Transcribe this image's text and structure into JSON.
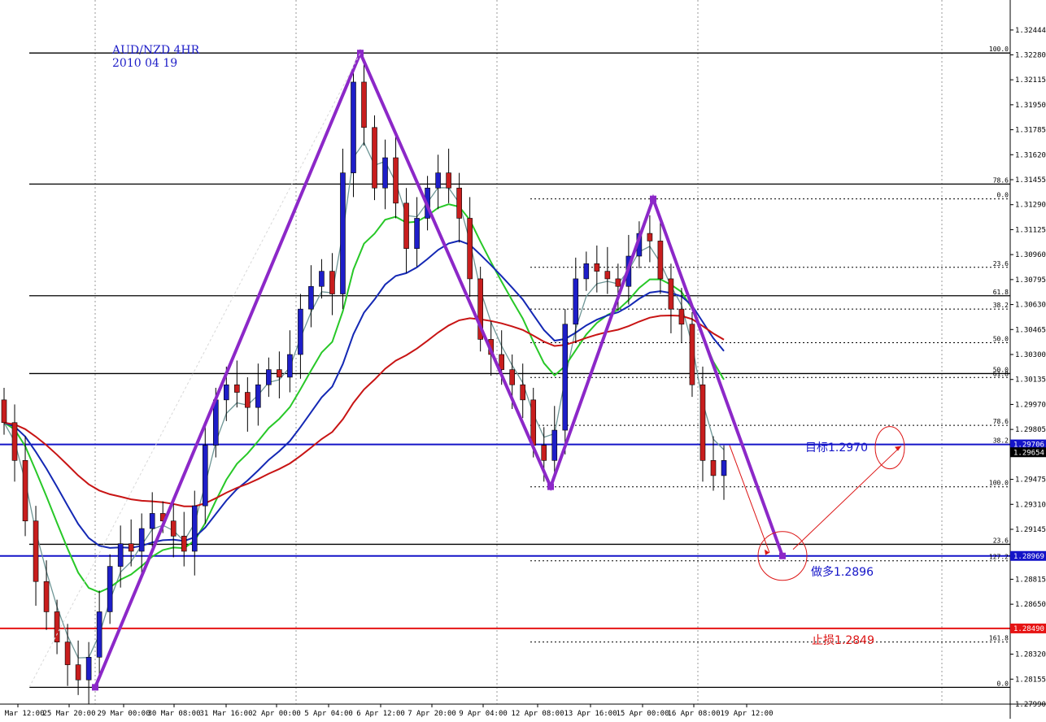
{
  "colors": {
    "background": "#ffffff",
    "bull_candle": "#1e1ec8",
    "bear_candle": "#c81e1e",
    "pattern": "#8c28c8",
    "support_line": "#1414c8",
    "stop_line": "#e61414",
    "ma_fast": "#6e9696",
    "ma_green": "#28c828",
    "ma_blue": "#1428b4",
    "ma_red": "#c81414",
    "arrow": "#dc1414"
  },
  "header": {
    "symbol": "AUD/NZD 4HR",
    "date": "2010 04 19"
  },
  "annotations": {
    "target": "目标1.2970",
    "buy": "做多1.2896",
    "stop": "止损1.2849"
  },
  "chart_data": {
    "type": "candlestick",
    "title": "AUD/NZD 4HR",
    "subtitle": "2010 04 19",
    "ylim": [
      1.2799,
      1.3261
    ],
    "y_ticks": [
      1.3228,
      1.3195,
      1.3162,
      1.3129,
      1.3096,
      1.3063,
      1.303,
      1.2997,
      1.2964,
      1.2931,
      1.2898,
      1.2865,
      1.2832,
      1.2799,
      1.32444,
      1.3228,
      1.32115,
      1.3195,
      1.31785,
      1.3162,
      1.31455,
      1.3129,
      1.31125,
      1.3096,
      1.30795,
      1.3063,
      1.30465,
      1.303,
      1.30135,
      1.2997,
      1.29805,
      1.2964,
      1.29475,
      1.2931,
      1.29145,
      1.2898,
      1.28815,
      1.2865,
      1.28485,
      1.2832,
      1.28155,
      1.2799
    ],
    "y_tick_labels": [
      "1.32444",
      "1.32280",
      "1.32115",
      "1.31950",
      "1.31785",
      "1.31620",
      "1.31455",
      "1.31290",
      "1.31125",
      "1.30960",
      "1.30795",
      "1.30630",
      "1.30465",
      "1.30300",
      "1.30135",
      "1.29970",
      "1.29805",
      "1.29640",
      "1.29475",
      "1.29310",
      "1.29145",
      "1.28980",
      "1.28815",
      "1.28650",
      "1.28485",
      "1.28320",
      "1.28155",
      "1.27990"
    ],
    "price_flags": [
      {
        "label": "1.29706",
        "color": "#1414c8"
      },
      {
        "label": "1.29654",
        "color": "#000000"
      },
      {
        "label": "1.28969",
        "color": "#1414c8"
      },
      {
        "label": "1.28490",
        "color": "#e61414"
      }
    ],
    "x_tick_labels": [
      "24 Mar 12:00",
      "25 Mar 20:00",
      "29 Mar 00:00",
      "30 Mar 08:00",
      "31 Mar 16:00",
      "2 Apr 00:00",
      "5 Apr 04:00",
      "6 Apr 12:00",
      "7 Apr 20:00",
      "9 Apr 04:00",
      "12 Apr 08:00",
      "13 Apr 16:00",
      "15 Apr 00:00",
      "16 Apr 08:00",
      "19 Apr 12:00"
    ],
    "horizontal_levels": [
      {
        "price": 1.32292,
        "color": "#000000",
        "label": "100.0"
      },
      {
        "price": 1.31426,
        "color": "#000000",
        "label": "78.6"
      },
      {
        "price": 1.30688,
        "color": "#000000",
        "label": "61.8"
      },
      {
        "price": 1.30174,
        "color": "#000000",
        "label": "50.0"
      },
      {
        "price": 1.29706,
        "color": "#1414c8",
        "label": "38.2"
      },
      {
        "price": 1.29046,
        "color": "#000000",
        "label": "23.6"
      },
      {
        "price": 1.28969,
        "color": "#1414c8",
        "label": ""
      },
      {
        "price": 1.2849,
        "color": "#e61414",
        "label": ""
      },
      {
        "price": 1.28101,
        "color": "#000000",
        "label": "0.0"
      }
    ],
    "dotted_levels": [
      {
        "price": 1.31328,
        "label": "0.0"
      },
      {
        "price": 1.30876,
        "label": "23.6"
      },
      {
        "price": 1.306,
        "label": "38.2"
      },
      {
        "price": 1.30378,
        "label": "50.0"
      },
      {
        "price": 1.30148,
        "label": "61.8"
      },
      {
        "price": 1.29832,
        "label": "78.6"
      },
      {
        "price": 1.29426,
        "label": "100.0"
      },
      {
        "price": 1.28937,
        "label": "127.2"
      },
      {
        "price": 1.284,
        "label": "161.8"
      }
    ],
    "pattern_points": [
      {
        "bar": 0,
        "price": 1.28101
      },
      {
        "bar": 1,
        "price": 1.32292
      },
      {
        "bar": 2,
        "price": 1.29426
      },
      {
        "bar": 3,
        "price": 1.31328
      },
      {
        "bar": 4,
        "price": 1.28969
      }
    ],
    "closes": [
      1.2985,
      1.296,
      1.292,
      1.288,
      1.286,
      1.284,
      1.2825,
      1.2815,
      1.283,
      1.286,
      1.289,
      1.2905,
      1.29,
      1.2915,
      1.2925,
      1.292,
      1.291,
      1.29,
      1.293,
      1.297,
      1.3,
      1.301,
      1.3005,
      1.2995,
      1.301,
      1.302,
      1.3015,
      1.303,
      1.306,
      1.3075,
      1.3085,
      1.307,
      1.315,
      1.321,
      1.318,
      1.314,
      1.316,
      1.313,
      1.31,
      1.312,
      1.314,
      1.315,
      1.314,
      1.312,
      1.308,
      1.304,
      1.303,
      1.302,
      1.301,
      1.3,
      1.297,
      1.296,
      1.298,
      1.305,
      1.308,
      1.309,
      1.3085,
      1.308,
      1.3075,
      1.3095,
      1.311,
      1.3105,
      1.308,
      1.306,
      1.305,
      1.301,
      1.296,
      1.295,
      1.296
    ]
  }
}
